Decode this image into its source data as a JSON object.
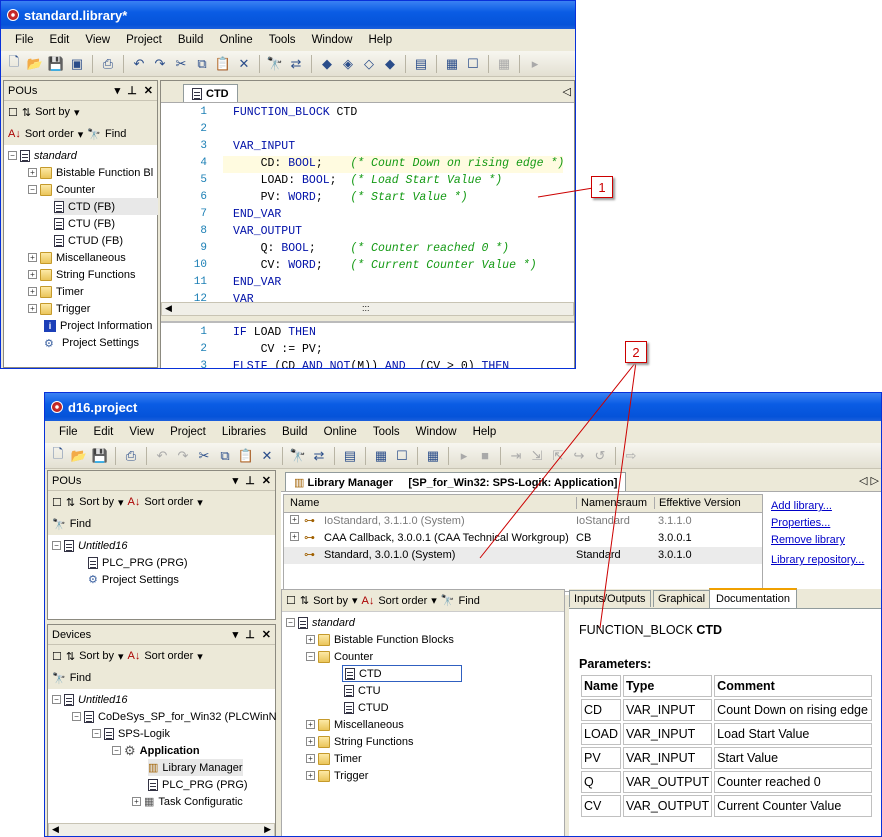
{
  "win1": {
    "title": "standard.library*",
    "menu": [
      "File",
      "Edit",
      "View",
      "Project",
      "Build",
      "Online",
      "Tools",
      "Window",
      "Help"
    ],
    "pous_title": "POUs",
    "sort_by": "Sort by",
    "sort_order": "Sort order",
    "find": "Find",
    "tree": {
      "root": "standard",
      "items": [
        "Bistable Function Bl",
        "Counter",
        "CTD (FB)",
        "CTU (FB)",
        "CTUD (FB)",
        "Miscellaneous",
        "String Functions",
        "Timer",
        "Trigger",
        "Project Information",
        "Project Settings"
      ]
    },
    "tab": "CTD",
    "code_top": [
      {
        "n": "1",
        "t": "FUNCTION_BLOCK CTD"
      },
      {
        "n": "2",
        "t": ""
      },
      {
        "n": "3",
        "t": "VAR_INPUT"
      },
      {
        "n": "4",
        "t": "    CD: BOOL;    (* Count Down on rising edge *)"
      },
      {
        "n": "5",
        "t": "    LOAD: BOOL;  (* Load Start Value *)"
      },
      {
        "n": "6",
        "t": "    PV: WORD;    (* Start Value *)"
      },
      {
        "n": "7",
        "t": "END_VAR"
      },
      {
        "n": "8",
        "t": "VAR_OUTPUT"
      },
      {
        "n": "9",
        "t": "    Q: BOOL;     (* Counter reached 0 *)"
      },
      {
        "n": "10",
        "t": "    CV: WORD;    (* Current Counter Value *)"
      },
      {
        "n": "11",
        "t": "END_VAR"
      },
      {
        "n": "12",
        "t": "VAR"
      }
    ],
    "code_bottom": [
      {
        "n": "1",
        "t": "IF LOAD THEN"
      },
      {
        "n": "2",
        "t": "    CV := PV;"
      },
      {
        "n": "3",
        "t": "ELSIF (CD AND NOT(M)) AND  (CV > 0) THEN"
      }
    ]
  },
  "callouts": [
    "1",
    "2"
  ],
  "win2": {
    "title": "d16.project",
    "menu": [
      "File",
      "Edit",
      "View",
      "Project",
      "Libraries",
      "Build",
      "Online",
      "Tools",
      "Window",
      "Help"
    ],
    "pous_title": "POUs",
    "sort_by": "Sort by",
    "sort_order": "Sort order",
    "find": "Find",
    "pous_tree": [
      "Untitled16",
      "PLC_PRG (PRG)",
      "Project Settings"
    ],
    "devices_title": "Devices",
    "devices_tree": [
      "Untitled16",
      "CoDeSys_SP_for_Win32 (PLCWinN",
      "SPS-Logik",
      "Application",
      "Library Manager",
      "PLC_PRG (PRG)",
      "Task Configuratic"
    ],
    "libman_tab": "Library Manager",
    "libman_ctx": "[SP_for_Win32: SPS-Logik: Application]",
    "lib_headers": [
      "Name",
      "Namensraum",
      "Effektive Version"
    ],
    "libs": [
      {
        "name": "IoStandard, 3.1.1.0 (System)",
        "ns": "IoStandard",
        "ver": "3.1.1.0"
      },
      {
        "name": "CAA Callback, 3.0.0.1 (CAA Technical Workgroup)",
        "ns": "CB",
        "ver": "3.0.0.1"
      },
      {
        "name": "Standard, 3.0.1.0 (System)",
        "ns": "Standard",
        "ver": "3.0.1.0"
      }
    ],
    "links": [
      "Add library...",
      "Properties...",
      "Remove library",
      "Library repository..."
    ],
    "lib_tree": [
      "standard",
      "Bistable Function Blocks",
      "Counter",
      "CTD",
      "CTU",
      "CTUD",
      "Miscellaneous",
      "String Functions",
      "Timer",
      "Trigger"
    ],
    "doc_tabs": [
      "Inputs/Outputs",
      "Graphical",
      "Documentation"
    ],
    "doc_header_prefix": "FUNCTION_BLOCK ",
    "doc_header_name": "CTD",
    "params_label": "Parameters:",
    "param_headers": [
      "Name",
      "Type",
      "Comment"
    ],
    "params": [
      [
        "CD",
        "VAR_INPUT",
        "Count Down on rising edge"
      ],
      [
        "LOAD",
        "VAR_INPUT",
        "Load Start Value"
      ],
      [
        "PV",
        "VAR_INPUT",
        "Start Value"
      ],
      [
        "Q",
        "VAR_OUTPUT",
        "Counter reached 0"
      ],
      [
        "CV",
        "VAR_OUTPUT",
        "Current Counter Value"
      ]
    ]
  }
}
